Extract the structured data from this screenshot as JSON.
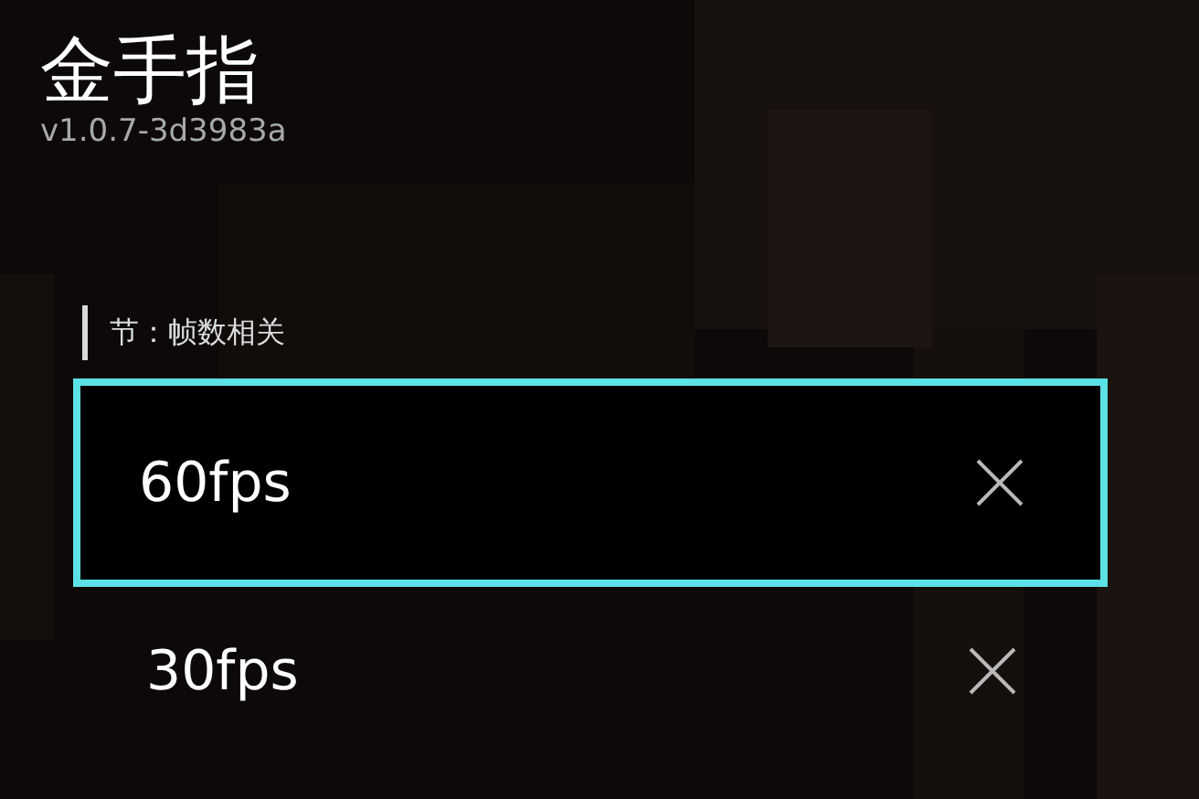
{
  "header": {
    "title": "金手指",
    "version": "v1.0.7-3d3983a"
  },
  "section": {
    "label": "节：帧数相关"
  },
  "cheats": [
    {
      "name": "60fps",
      "selected": true,
      "on": false
    },
    {
      "name": "30fps",
      "selected": false,
      "on": false
    }
  ]
}
